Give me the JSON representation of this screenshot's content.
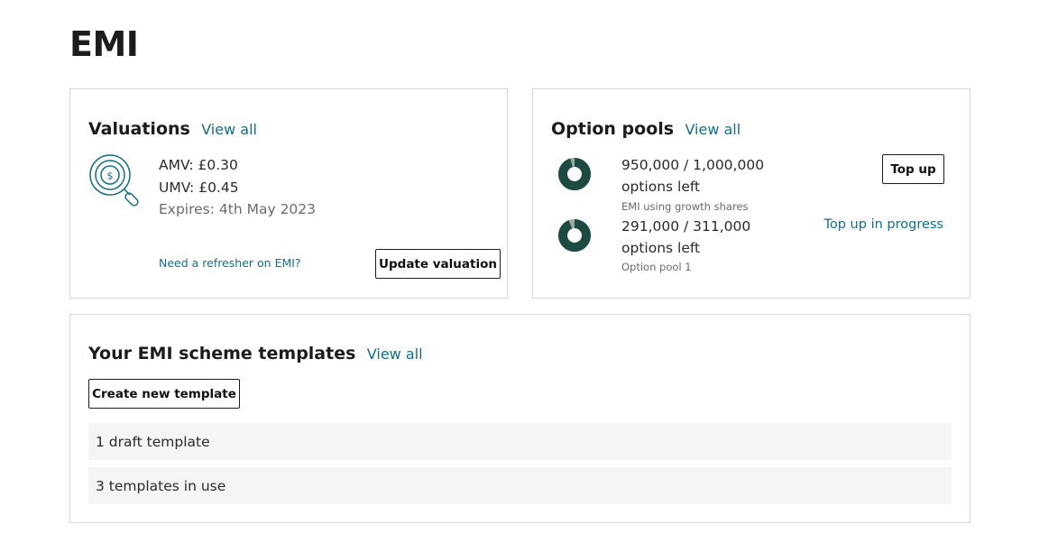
{
  "page": {
    "title": "EMI"
  },
  "colors": {
    "link": "#136f86",
    "donut_fill": "#1d4a40",
    "donut_remaining_track": "#9aa7a3"
  },
  "valuations": {
    "heading": "Valuations",
    "view_all": "View all",
    "amv": "AMV: £0.30",
    "umv": "UMV: £0.45",
    "expires": "Expires: 4th May 2023",
    "refresher_link": "Need a refresher on EMI?",
    "update_button": "Update valuation",
    "icon": "valuation-magnifier-icon"
  },
  "option_pools": {
    "heading": "Option pools",
    "view_all": "View all",
    "pools": [
      {
        "count": "950,000 / 1,000,000",
        "unit": "options left",
        "name": "EMI using growth shares",
        "remaining_fraction": 0.95,
        "action": "Top up"
      },
      {
        "count": "291,000 / 311,000",
        "unit": "options left",
        "name": "Option pool 1",
        "remaining_fraction": 0.9357,
        "action": "Top up in progress"
      }
    ]
  },
  "templates": {
    "heading": "Your EMI scheme templates",
    "view_all": "View all",
    "create_button": "Create new template",
    "rows": [
      {
        "label": "1 draft template"
      },
      {
        "label": "3 templates in use"
      }
    ]
  }
}
